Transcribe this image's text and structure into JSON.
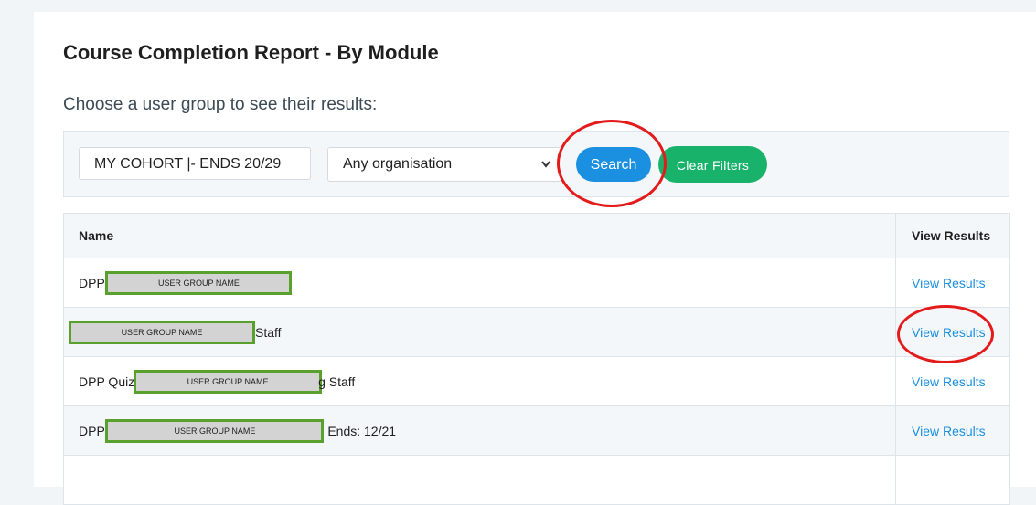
{
  "page": {
    "title": "Course Completion Report - By Module",
    "subtitle": "Choose a user group to see their results:"
  },
  "filters": {
    "group_value": "MY COHORT |- ENDS 20/29",
    "organisation_selected": "Any organisation",
    "search_label": "Search",
    "clear_label": "Clear Filters"
  },
  "table": {
    "headers": {
      "name": "Name",
      "results": "View Results"
    },
    "rows": [
      {
        "prefix": "DPP ",
        "redaction": "USER GROUP NAME",
        "suffix": "",
        "link": "View Results"
      },
      {
        "prefix": "",
        "redaction": "USER GROUP NAME",
        "suffix": "Staff",
        "link": "View Results"
      },
      {
        "prefix": "DPP Quiz ",
        "redaction": "USER GROUP NAME",
        "suffix": "g Staff",
        "link": "View Results"
      },
      {
        "prefix": "DPP ",
        "redaction": "USER GROUP NAME",
        "suffix": " Ends: 12/21",
        "link": "View Results"
      }
    ]
  },
  "colors": {
    "accent_blue": "#1b8fe0",
    "clear_green": "#18b26b",
    "annotation_red": "#e31b1b",
    "redaction_border": "#5aa02c"
  }
}
